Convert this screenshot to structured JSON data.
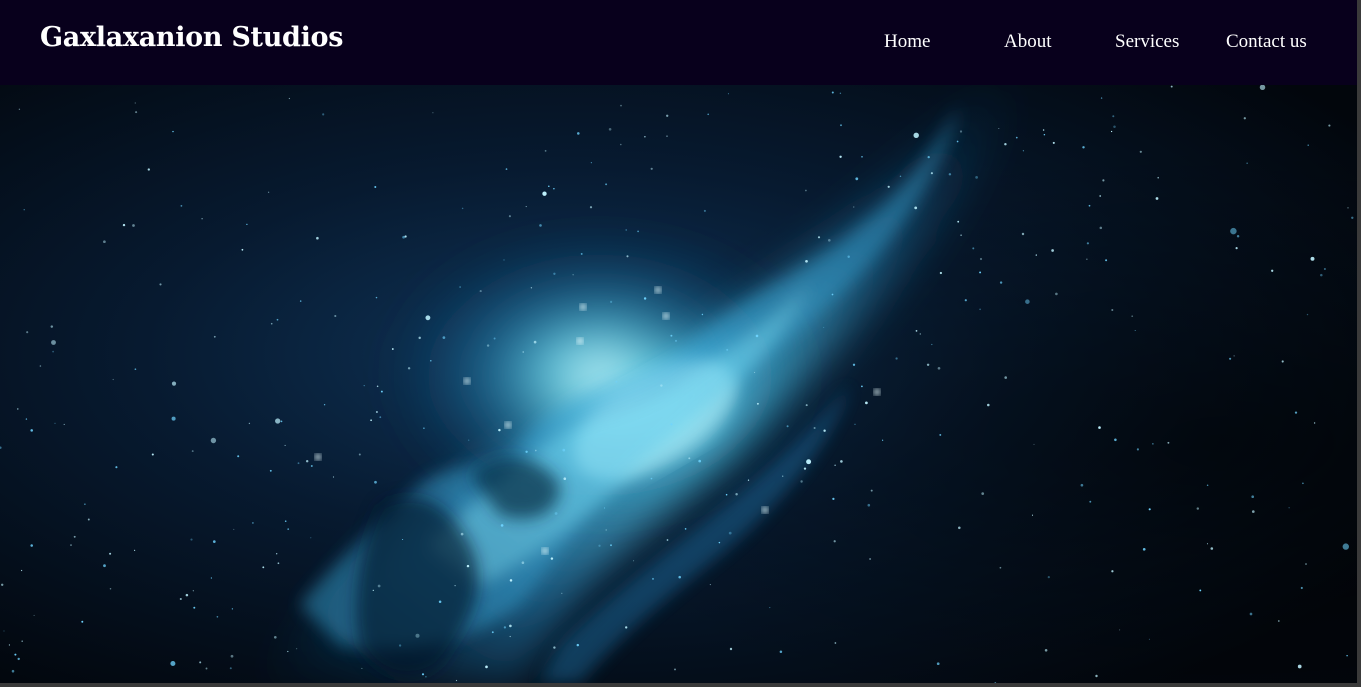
{
  "navbar": {
    "brand": "Gaxlaxanion Studios",
    "links": [
      {
        "label": "Home"
      },
      {
        "label": "About"
      },
      {
        "label": "Services"
      },
      {
        "label": "Contact us"
      }
    ]
  },
  "hero": {
    "image": "galaxy-nebula-background",
    "colors": {
      "space_dark": "#030a14",
      "nebula_glow": "#5fe0ff",
      "nebula_mid": "#1f7fb8",
      "nav_background": "#08001c"
    }
  }
}
